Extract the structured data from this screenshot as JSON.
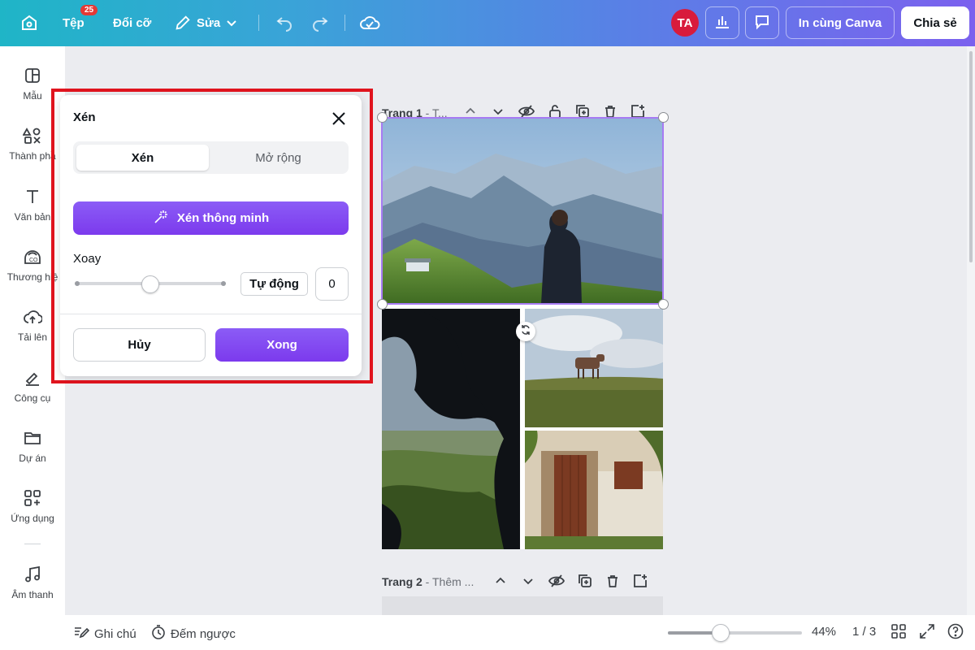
{
  "topbar": {
    "file_label": "Tệp",
    "file_badge": "25",
    "resize_label": "Đổi cỡ",
    "edit_label": "Sửa",
    "avatar_initials": "TA",
    "print_label": "In cùng Canva",
    "share_label": "Chia sẻ"
  },
  "sidebar": {
    "items": [
      {
        "label": "Mẫu",
        "icon": "template-icon"
      },
      {
        "label": "Thành phầ",
        "icon": "elements-icon"
      },
      {
        "label": "Văn bản",
        "icon": "text-icon"
      },
      {
        "label": "Thương hiệ",
        "icon": "brand-icon"
      },
      {
        "label": "Tải lên",
        "icon": "upload-icon"
      },
      {
        "label": "Công cụ",
        "icon": "tools-icon"
      },
      {
        "label": "Dự án",
        "icon": "folder-icon"
      },
      {
        "label": "Ứng dụng",
        "icon": "apps-icon"
      },
      {
        "label": "Âm thanh",
        "icon": "music-icon"
      }
    ]
  },
  "crop_panel": {
    "title": "Xén",
    "tab_crop": "Xén",
    "tab_expand": "Mở rộng",
    "smart_crop_label": "Xén thông minh",
    "rotate_label": "Xoay",
    "auto_label": "Tự động",
    "rotate_value": "0",
    "rotate_slider_fraction": 0.5,
    "cancel_label": "Hủy",
    "done_label": "Xong"
  },
  "pages": [
    {
      "label": "Trang 1",
      "suffix": " - T..."
    },
    {
      "label": "Trang 2",
      "suffix": " - Thêm ..."
    }
  ],
  "bottombar": {
    "notes_label": "Ghi chú",
    "timer_label": "Đếm ngược",
    "zoom_value": "44%",
    "zoom_fraction": 0.44,
    "page_counter": "1 / 3"
  },
  "colors": {
    "accent": "#7c3aed",
    "highlight": "#e0141e",
    "avatar": "#d81b3c"
  }
}
